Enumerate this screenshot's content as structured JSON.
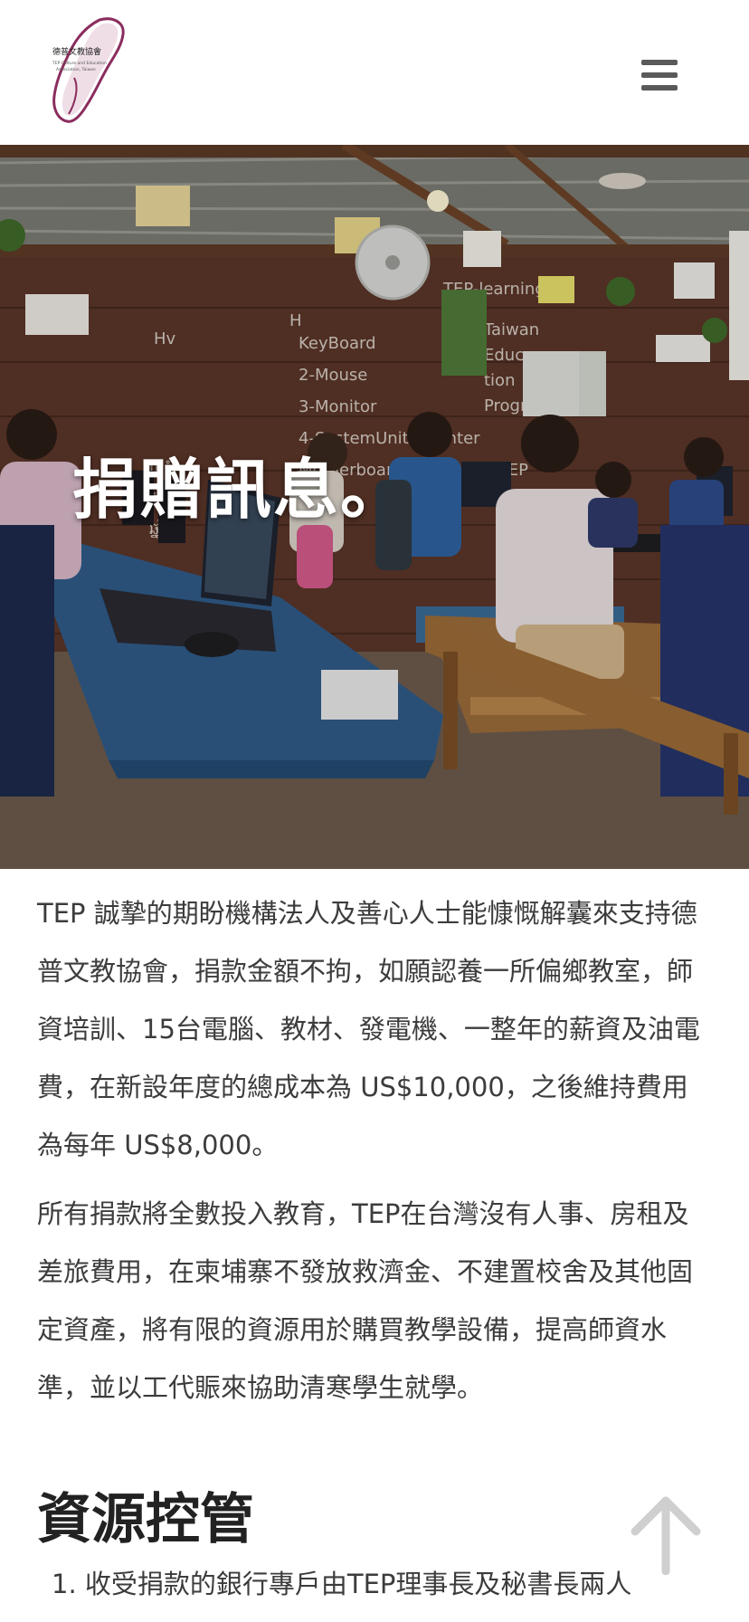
{
  "header": {
    "logo": {
      "org_name": "德普文教協會",
      "org_name_en": "TEP Culture and Education Association, Taiwan",
      "icon": "taiwan-silhouette-logo-icon",
      "color": "#8b2d5e"
    },
    "menu_icon": "hamburger-menu-icon"
  },
  "hero": {
    "title": "捐贈訊息。",
    "image": "classroom-photo"
  },
  "content": {
    "paragraphs": [
      "TEP 誠摯的期盼機構法人及善心人士能慷慨解囊來支持德普文教協會，捐款金額不拘，如願認養一所偏鄉教室，師資培訓、15台電腦、教材、發電機、一整年的薪資及油電費，在新設年度的總成本為 US$10,000，之後維持費用為每年 US$8,000。",
      "所有捐款將全數投入教育，TEP在台灣沒有人事、房租及差旅費用，在柬埔寨不發放救濟金、不建置校舍及其他固定資產，將有限的資源用於購買教學設備，提高師資水準，並以工代賑來協助清寒學生就學。"
    ]
  },
  "section": {
    "title": "資源控管",
    "items": [
      "1. 收受捐款的銀行專戶由TEP理事長及秘書長兩人"
    ]
  },
  "scroll_top": {
    "icon": "arrow-up-icon",
    "color": "#cfcfcf"
  }
}
